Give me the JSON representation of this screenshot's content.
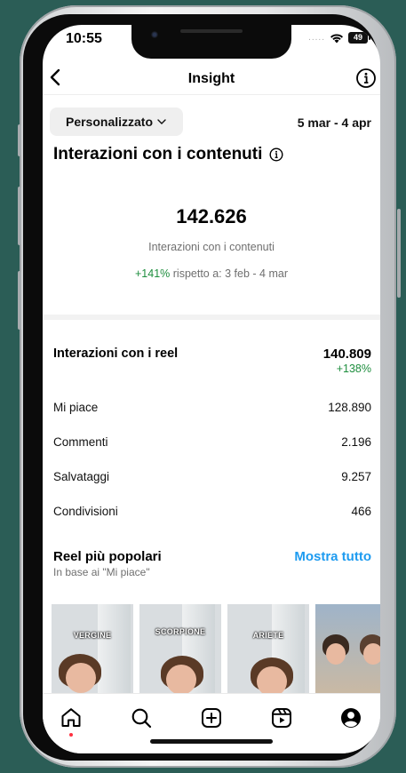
{
  "status": {
    "time": "10:55",
    "battery": "49",
    "signal_dots": "....."
  },
  "header": {
    "title": "Insight"
  },
  "filter": {
    "label": "Personalizzato",
    "date_range": "5 mar - 4 apr"
  },
  "content_interactions": {
    "title": "Interazioni con i contenuti",
    "total": "142.626",
    "caption": "Interazioni con i contenuti",
    "change": "+141%",
    "compare_text": " rispetto a: 3 feb - 4 mar"
  },
  "reels": {
    "title": "Interazioni con i reel",
    "total": "140.809",
    "change": "+138%",
    "metrics": [
      {
        "label": "Mi piace",
        "value": "128.890"
      },
      {
        "label": "Commenti",
        "value": "2.196"
      },
      {
        "label": "Salvataggi",
        "value": "9.257"
      },
      {
        "label": "Condivisioni",
        "value": "466"
      }
    ]
  },
  "popular": {
    "title": "Reel più popolari",
    "subtitle": "In base ai \"Mi piace\"",
    "show_all": "Mostra tutto",
    "thumbnails": [
      {
        "label": "VERGINE"
      },
      {
        "label": "SCORPIONE"
      },
      {
        "label": "ARIETE"
      },
      {
        "label": ""
      }
    ]
  },
  "colors": {
    "green": "#1e8e3e",
    "link_blue": "#1d9bf0",
    "notification_red": "#ff3040",
    "background": "#2b5d56"
  },
  "icons": {
    "back": "chevron-left-icon",
    "info": "info-circle-icon",
    "tabs": [
      "home-icon",
      "search-icon",
      "add-square-icon",
      "reels-icon",
      "profile-icon"
    ]
  }
}
